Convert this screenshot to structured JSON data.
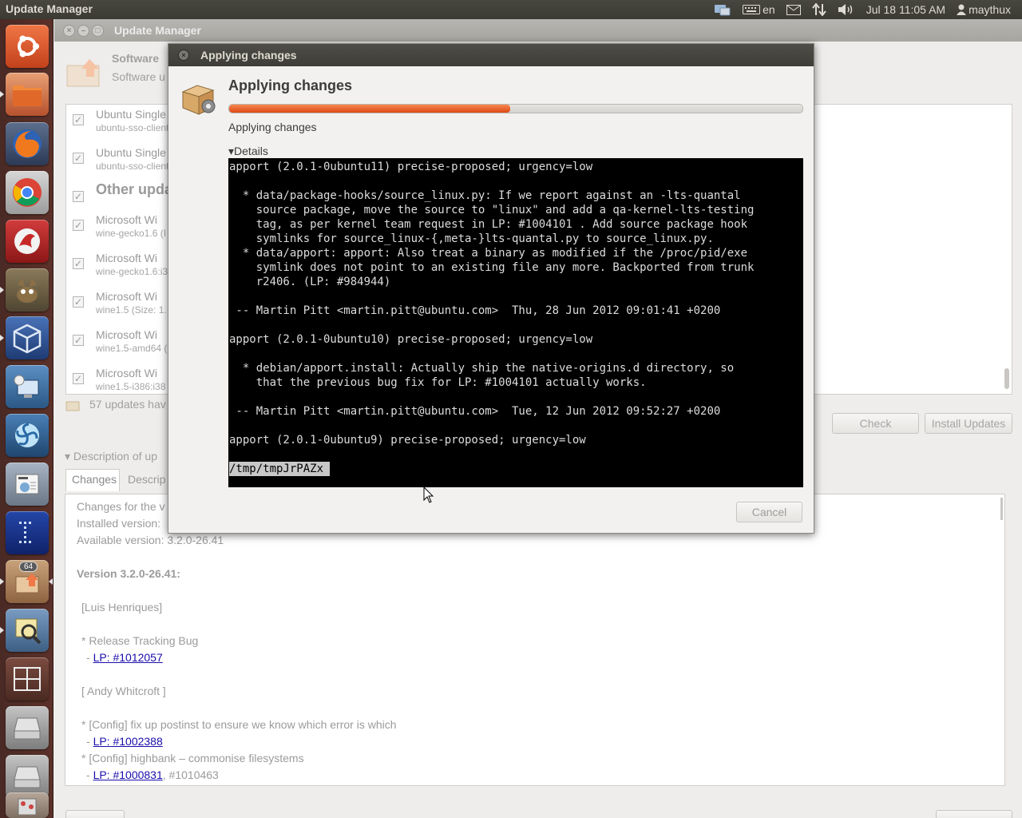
{
  "topbar": {
    "app_title": "Update Manager",
    "keyboard": "en",
    "clock": "Jul 18 11:05 AM",
    "user": "maythux"
  },
  "launcher": {
    "icons": [
      "ubuntu-dash-icon",
      "files-icon",
      "firefox-icon",
      "chrome-icon",
      "red-app-icon",
      "gimp-icon",
      "virtualbox-icon",
      "remote-desktop-icon",
      "blue-swirl-icon",
      "news-icon",
      "calculator-icon",
      "update-manager-icon",
      "image-viewer-icon",
      "workspace-icon",
      "disk-icon",
      "disk-icon-2",
      "trash-icon"
    ],
    "badge": "64"
  },
  "main": {
    "title": "Update Manager",
    "header_line1": "Software",
    "header_line2": "Software u",
    "rows": [
      {
        "name": "Ubuntu Single",
        "sub": "ubuntu-sso-client"
      },
      {
        "name": "Ubuntu Single",
        "sub": "ubuntu-sso-client"
      },
      {
        "group": "Other upda"
      },
      {
        "name": "Microsoft Wi",
        "sub": "wine-gecko1.6 (I"
      },
      {
        "name": "Microsoft Wi",
        "sub": "wine-gecko1.6:i3"
      },
      {
        "name": "Microsoft Wi",
        "sub": "wine1.5 (Size: 1."
      },
      {
        "name": "Microsoft Wi",
        "sub": "wine1.5-amd64 ("
      },
      {
        "name": "Microsoft Wi",
        "sub": "wine1.5-i386:i38"
      }
    ],
    "updates_count": "57 updates hav",
    "check_label": "Check",
    "install_label": "Install Updates",
    "description_label": "Description of up",
    "tab_changes": "Changes",
    "tab_description": "Descrip",
    "desc_lines": {
      "l1": "Changes for the v",
      "l2": "Installed version:",
      "l3": "Available version: 3.2.0-26.41",
      "version": "Version 3.2.0-26.41:",
      "l4": "[Luis Henriques]",
      "l5": "* Release Tracking Bug",
      "link1": "LP: #1012057",
      "l6": "[ Andy Whitcroft ]",
      "l7": "* [Config] fix up postinst to ensure we know which error is which",
      "link2": "LP: #1002388",
      "l8": "* [Config] highbank – commonise filesystems",
      "link3": "LP: #1000831",
      "l9": ", #1010463",
      "dash": "-"
    }
  },
  "dialog": {
    "title": "Applying changes",
    "heading": "Applying changes",
    "progress": 0.49,
    "status": "Applying changes",
    "details_label": "Details",
    "cancel_label": "Cancel",
    "terminal": [
      "apport (2.0.1-0ubuntu11) precise-proposed; urgency=low",
      "",
      "  * data/package-hooks/source_linux.py: If we report against an -lts-quantal",
      "    source package, move the source to \"linux\" and add a qa-kernel-lts-testing",
      "    tag, as per kernel team request in LP: #1004101 . Add source package hook",
      "    symlinks for source_linux-{,meta-}lts-quantal.py to source_linux.py.",
      "  * data/apport: apport: Also treat a binary as modified if the /proc/pid/exe",
      "    symlink does not point to an existing file any more. Backported from trunk",
      "    r2406. (LP: #984944)",
      "",
      " -- Martin Pitt <martin.pitt@ubuntu.com>  Thu, 28 Jun 2012 09:01:41 +0200",
      "",
      "apport (2.0.1-0ubuntu10) precise-proposed; urgency=low",
      "",
      "  * debian/apport.install: Actually ship the native-origins.d directory, so",
      "    that the previous bug fix for LP: #1004101 actually works.",
      "",
      " -- Martin Pitt <martin.pitt@ubuntu.com>  Tue, 12 Jun 2012 09:52:27 +0200",
      "",
      "apport (2.0.1-0ubuntu9) precise-proposed; urgency=low",
      ""
    ],
    "terminal_selected": "/tmp/tmpJrPAZx "
  }
}
